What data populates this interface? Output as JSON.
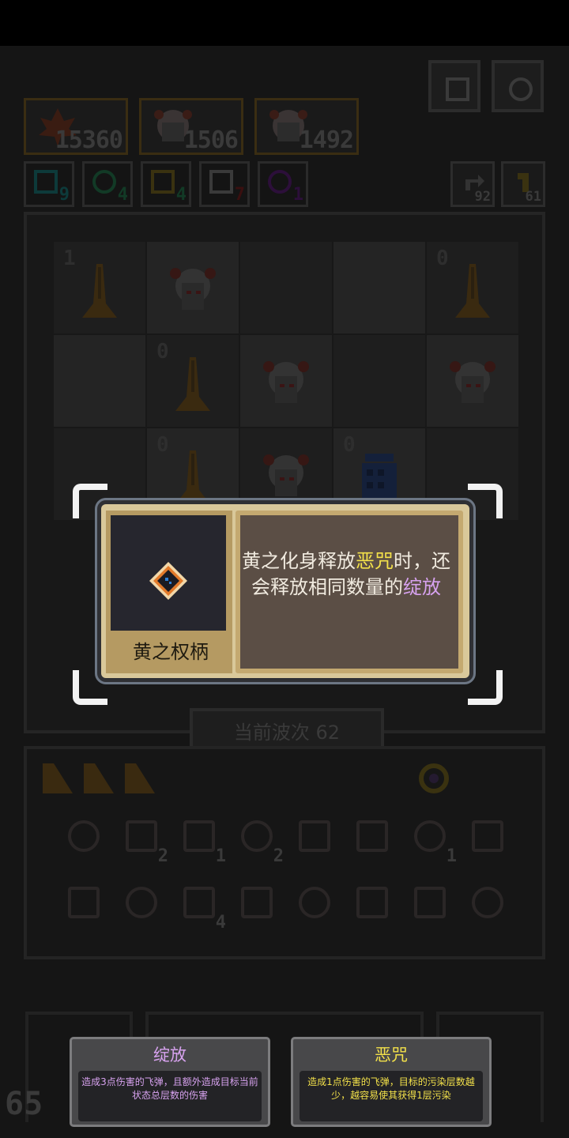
{
  "colors": {
    "popup_text": "#f1ebe0",
    "highlight_curse": "#f3e14a",
    "highlight_bloom": "#d7a2ef",
    "card_curse_text": "#f3e14a",
    "card_bloom_text": "#d7a2ef"
  },
  "heroes": [
    {
      "icon": "maple-leaf-icon",
      "value": "15360"
    },
    {
      "icon": "hero-portrait-icon",
      "value": "1506"
    },
    {
      "icon": "hero-portrait-icon",
      "value": "1492"
    }
  ],
  "resources": [
    {
      "icon": "cyan-rune-icon",
      "value": "9"
    },
    {
      "icon": "green-rune-icon",
      "value": "4"
    },
    {
      "icon": "yellow-spark-icon",
      "value": "4"
    },
    {
      "icon": "red-eye-icon",
      "value": "7"
    },
    {
      "icon": "purple-ring-icon",
      "value": "1"
    }
  ],
  "counters": [
    {
      "icon": "refresh-arrow-icon",
      "value": "92"
    },
    {
      "icon": "key-icon",
      "value": "61"
    }
  ],
  "board_cells": [
    {
      "level": "1",
      "unit": "golden-tower"
    },
    {
      "level": "",
      "unit": "hero"
    },
    {
      "level": "",
      "unit": ""
    },
    {
      "level": "",
      "unit": ""
    },
    {
      "level": "0",
      "unit": "golden-tower"
    },
    {
      "level": "",
      "unit": ""
    },
    {
      "level": "0",
      "unit": "golden-tower"
    },
    {
      "level": "",
      "unit": "hero"
    },
    {
      "level": "",
      "unit": ""
    },
    {
      "level": "",
      "unit": "hero"
    },
    {
      "level": "",
      "unit": ""
    },
    {
      "level": "0",
      "unit": "golden-tower"
    },
    {
      "level": "",
      "unit": "hero"
    },
    {
      "level": "0",
      "unit": "blue-jar"
    },
    {
      "level": "",
      "unit": ""
    }
  ],
  "wave": {
    "label": "当前波次 62"
  },
  "wave_counter": "65",
  "inventory": [
    {
      "icon": "hammer-icon",
      "count": ""
    },
    {
      "icon": "scroll-icon",
      "count": "2"
    },
    {
      "icon": "heart-gem-icon",
      "count": "1"
    },
    {
      "icon": "fang-mouth-icon",
      "count": "2"
    },
    {
      "icon": "chest-icon",
      "count": ""
    },
    {
      "icon": "flower-icon",
      "count": ""
    },
    {
      "icon": "bone-icon",
      "count": "1"
    },
    {
      "icon": "dna-icon",
      "count": ""
    },
    {
      "icon": "rocket-icon",
      "count": ""
    },
    {
      "icon": "cup-icon",
      "count": ""
    },
    {
      "icon": "blocks-icon",
      "count": "4"
    },
    {
      "icon": "potion-icon",
      "count": ""
    },
    {
      "icon": "crescent-icon",
      "count": ""
    },
    {
      "icon": "green-orb-icon",
      "count": ""
    },
    {
      "icon": "maple-leaf-icon",
      "count": ""
    },
    {
      "icon": "diamond-gem-icon",
      "count": ""
    }
  ],
  "popup": {
    "item_name": "黄之权柄",
    "item_icon": "diamond-sigil-icon",
    "desc_pre": "黄之化身释放",
    "desc_curse": "恶咒",
    "desc_mid": "时，还会释放相同数量的",
    "desc_bloom": "绽放"
  },
  "cards": [
    {
      "title": "绽放",
      "body": "造成3点伤害的飞弹，且额外造成目标当前状态总层数的伤害"
    },
    {
      "title": "恶咒",
      "body": "造成1点伤害的飞弹，目标的污染层数越少，越容易使其获得1层污染"
    }
  ]
}
